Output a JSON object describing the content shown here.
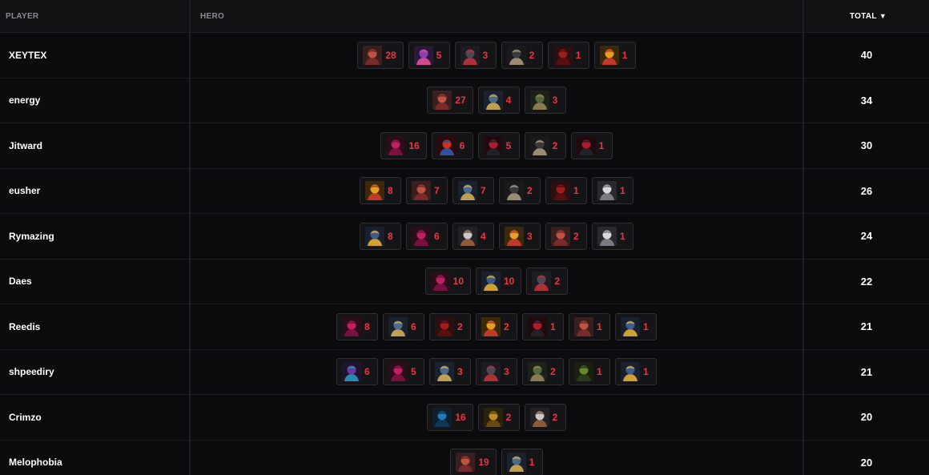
{
  "header": {
    "player": "PLAYER",
    "hero": "HERO",
    "total": "TOTAL",
    "sort_icon": "▼"
  },
  "palette": {
    "accent_red": "#ee3344",
    "portraits": {
      "red-skin-hero": [
        "#3a1f1f",
        "#c0533f",
        "#7a2a2a"
      ],
      "purple-hair-hero": [
        "#2a1a3a",
        "#8a3fb0",
        "#d04a90"
      ],
      "dark-masked-hero": [
        "#1c1c22",
        "#4a4a55",
        "#b0303a"
      ],
      "black-suit-hero": [
        "#1a1a1c",
        "#3a3a3e",
        "#9a8a70"
      ],
      "crimson-cape-hero": [
        "#2a1010",
        "#a01c1c",
        "#5a0e0e"
      ],
      "golden-hair-hero": [
        "#3a2a0a",
        "#e0a020",
        "#c03a2a"
      ],
      "blue-armor-hero": [
        "#1a2230",
        "#4a6a90",
        "#c0a050"
      ],
      "green-gear-hero": [
        "#1c2218",
        "#556a3a",
        "#8a7a50"
      ],
      "pink-mask-hero": [
        "#2a0f1a",
        "#c02060",
        "#7a1040"
      ],
      "spider-hero": [
        "#2a0a0a",
        "#d0301f",
        "#3050a0"
      ],
      "red-black-hero": [
        "#200a0e",
        "#b01c2c",
        "#222226"
      ],
      "white-cloak-hero": [
        "#2a2a2e",
        "#d8d8dc",
        "#7a7a82"
      ],
      "blue-gold-hero": [
        "#1a2030",
        "#3a5a90",
        "#d0a030"
      ],
      "cyan-hood-hero": [
        "#0e1e2a",
        "#1f7ac0",
        "#0e3a5a"
      ],
      "gold-armor-hero": [
        "#2a220a",
        "#c0901f",
        "#6a4a10"
      ],
      "silver-hair-hero": [
        "#222226",
        "#c8c8cc",
        "#8a5a3a"
      ],
      "violet-tech-hero": [
        "#1e1430",
        "#6a3aa0",
        "#2a8ab0"
      ],
      "horned-hero": [
        "#1a2010",
        "#6a8a2a",
        "#2a3a1a"
      ]
    }
  },
  "rows": [
    {
      "player": "XEYTEX",
      "total": "40",
      "heroes": [
        {
          "icon": "red-skin-hero",
          "count": "28"
        },
        {
          "icon": "purple-hair-hero",
          "count": "5"
        },
        {
          "icon": "dark-masked-hero",
          "count": "3"
        },
        {
          "icon": "black-suit-hero",
          "count": "2"
        },
        {
          "icon": "crimson-cape-hero",
          "count": "1"
        },
        {
          "icon": "golden-hair-hero",
          "count": "1"
        }
      ]
    },
    {
      "player": "energy",
      "total": "34",
      "heroes": [
        {
          "icon": "red-skin-hero",
          "count": "27"
        },
        {
          "icon": "blue-armor-hero",
          "count": "4"
        },
        {
          "icon": "green-gear-hero",
          "count": "3"
        }
      ]
    },
    {
      "player": "Jitward",
      "total": "30",
      "heroes": [
        {
          "icon": "pink-mask-hero",
          "count": "16"
        },
        {
          "icon": "spider-hero",
          "count": "6"
        },
        {
          "icon": "red-black-hero",
          "count": "5"
        },
        {
          "icon": "black-suit-hero",
          "count": "2"
        },
        {
          "icon": "red-black-hero",
          "count": "1"
        }
      ]
    },
    {
      "player": "eusher",
      "total": "26",
      "heroes": [
        {
          "icon": "golden-hair-hero",
          "count": "8"
        },
        {
          "icon": "red-skin-hero",
          "count": "7"
        },
        {
          "icon": "blue-armor-hero",
          "count": "7"
        },
        {
          "icon": "black-suit-hero",
          "count": "2"
        },
        {
          "icon": "crimson-cape-hero",
          "count": "1"
        },
        {
          "icon": "white-cloak-hero",
          "count": "1"
        }
      ]
    },
    {
      "player": "Rymazing",
      "total": "24",
      "heroes": [
        {
          "icon": "blue-gold-hero",
          "count": "8"
        },
        {
          "icon": "pink-mask-hero",
          "count": "6"
        },
        {
          "icon": "silver-hair-hero",
          "count": "4"
        },
        {
          "icon": "golden-hair-hero",
          "count": "3"
        },
        {
          "icon": "red-skin-hero",
          "count": "2"
        },
        {
          "icon": "white-cloak-hero",
          "count": "1"
        }
      ]
    },
    {
      "player": "Daes",
      "total": "22",
      "heroes": [
        {
          "icon": "pink-mask-hero",
          "count": "10"
        },
        {
          "icon": "blue-gold-hero",
          "count": "10"
        },
        {
          "icon": "dark-masked-hero",
          "count": "2"
        }
      ]
    },
    {
      "player": "Reedis",
      "total": "21",
      "heroes": [
        {
          "icon": "pink-mask-hero",
          "count": "8"
        },
        {
          "icon": "blue-armor-hero",
          "count": "6"
        },
        {
          "icon": "crimson-cape-hero",
          "count": "2"
        },
        {
          "icon": "golden-hair-hero",
          "count": "2"
        },
        {
          "icon": "red-black-hero",
          "count": "1"
        },
        {
          "icon": "red-skin-hero",
          "count": "1"
        },
        {
          "icon": "blue-gold-hero",
          "count": "1"
        }
      ]
    },
    {
      "player": "shpeediry",
      "total": "21",
      "heroes": [
        {
          "icon": "violet-tech-hero",
          "count": "6"
        },
        {
          "icon": "pink-mask-hero",
          "count": "5"
        },
        {
          "icon": "blue-armor-hero",
          "count": "3"
        },
        {
          "icon": "dark-masked-hero",
          "count": "3"
        },
        {
          "icon": "green-gear-hero",
          "count": "2"
        },
        {
          "icon": "horned-hero",
          "count": "1"
        },
        {
          "icon": "blue-gold-hero",
          "count": "1"
        }
      ]
    },
    {
      "player": "Crimzo",
      "total": "20",
      "heroes": [
        {
          "icon": "cyan-hood-hero",
          "count": "16"
        },
        {
          "icon": "gold-armor-hero",
          "count": "2"
        },
        {
          "icon": "silver-hair-hero",
          "count": "2"
        }
      ]
    },
    {
      "player": "Melophobia",
      "total": "20",
      "heroes": [
        {
          "icon": "red-skin-hero",
          "count": "19"
        },
        {
          "icon": "blue-armor-hero",
          "count": "1"
        }
      ]
    }
  ]
}
